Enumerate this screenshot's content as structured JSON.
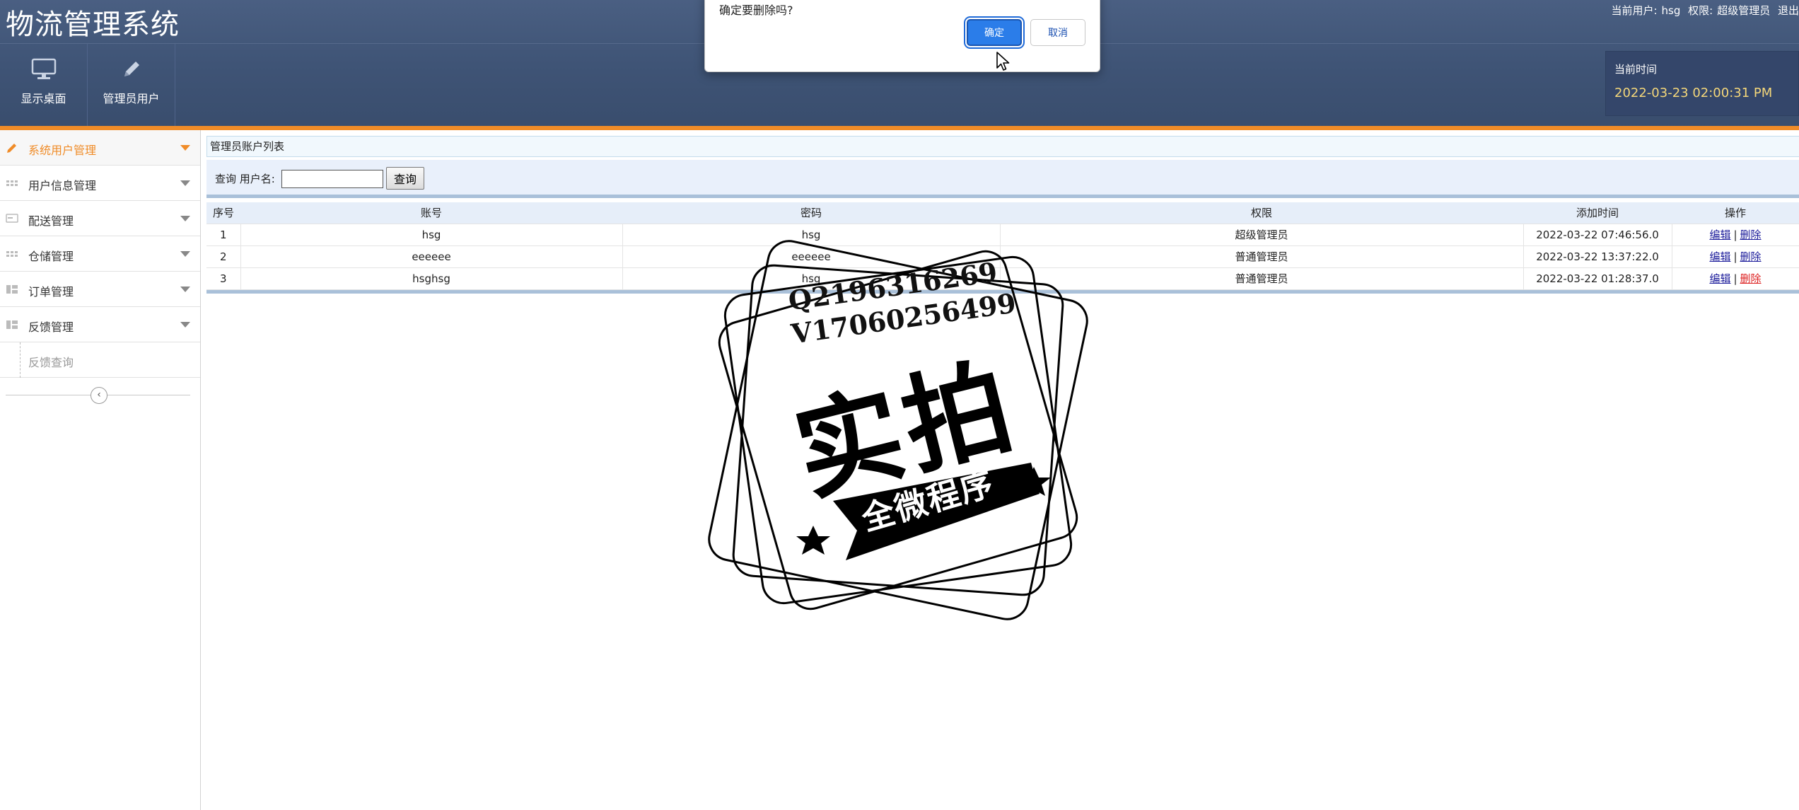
{
  "header": {
    "title": "物流管理系统",
    "user_label": "当前用户:",
    "user_name": "hsg",
    "role_label": "权限:",
    "role_name": "超级管理员",
    "logout": "退出",
    "nav": [
      {
        "label": "显示桌面",
        "icon": "monitor-icon"
      },
      {
        "label": "管理员用户",
        "icon": "pencil-icon"
      }
    ],
    "time_label": "当前时间",
    "time_value": "2022-03-23 02:00:31 PM"
  },
  "sidebar": {
    "items": [
      {
        "label": "系统用户管理",
        "icon": "pencil-icon",
        "active": true
      },
      {
        "label": "用户信息管理",
        "icon": "grid-icon"
      },
      {
        "label": "配送管理",
        "icon": "card-icon"
      },
      {
        "label": "仓储管理",
        "icon": "grid-icon"
      },
      {
        "label": "订单管理",
        "icon": "layout-icon"
      },
      {
        "label": "反馈管理",
        "icon": "layout-icon"
      }
    ],
    "sub_item": "反馈查询",
    "collapse_icon": "chevron-left-icon"
  },
  "panel": {
    "title": "管理员账户列表",
    "search_label": "查询 用户名:",
    "search_value": "",
    "search_button": "查询"
  },
  "table": {
    "headers": [
      "序号",
      "账号",
      "密码",
      "权限",
      "添加时间",
      "操作"
    ],
    "rows": [
      {
        "no": "1",
        "account": "hsg",
        "password": "hsg",
        "role": "超级管理员",
        "time": "2022-03-22 07:46:56.0",
        "edit": "编辑",
        "sep": "|",
        "del": "删除"
      },
      {
        "no": "2",
        "account": "eeeeee",
        "password": "eeeeee",
        "role": "普通管理员",
        "time": "2022-03-22 13:37:22.0",
        "edit": "编辑",
        "sep": "|",
        "del": "删除"
      },
      {
        "no": "3",
        "account": "hsghsg",
        "password": "hsg",
        "role": "普通管理员",
        "time": "2022-03-22 01:28:37.0",
        "edit": "编辑",
        "sep": "|",
        "del": "删除"
      }
    ]
  },
  "dialog": {
    "message": "确定要删除吗?",
    "ok": "确定",
    "cancel": "取消"
  },
  "watermark": {
    "qq": "Q2196316269",
    "vx": "V17060256499",
    "big": "实拍",
    "ribbon": "全微程序"
  },
  "colors": {
    "header_bg": "#3f5476",
    "accent": "#f08c28",
    "time_text": "#f4d77a",
    "primary_button": "#2b7de9"
  }
}
